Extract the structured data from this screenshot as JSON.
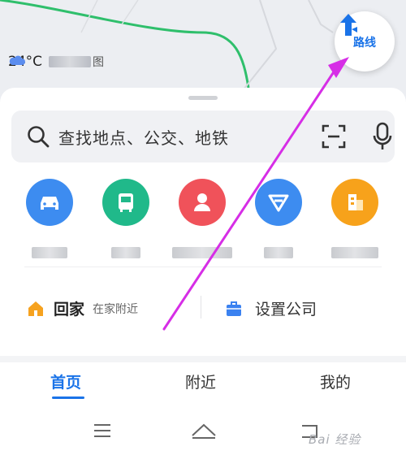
{
  "weather": {
    "temperature": "24°C",
    "suffix": "图",
    "icon": "cloud-icon"
  },
  "route_button": {
    "label": "路线",
    "icon": "route-arrow-icon"
  },
  "search": {
    "placeholder": "查找地点、公交、地铁",
    "scan_icon": "scan-icon",
    "mic_icon": "microphone-icon"
  },
  "shortcuts": [
    {
      "icon": "car-icon",
      "color": "#3d8cf0"
    },
    {
      "icon": "bus-icon",
      "color": "#20b98a"
    },
    {
      "icon": "person-icon",
      "color": "#f0525a"
    },
    {
      "icon": "route-badge-icon",
      "color": "#3d8cf0"
    },
    {
      "icon": "building-icon",
      "color": "#f7a21b"
    }
  ],
  "quick": {
    "home_label": "回家",
    "home_sub": "在家附近",
    "company_label": "设置公司"
  },
  "nav": {
    "tabs": [
      "首页",
      "附近",
      "我的"
    ],
    "active": 0
  },
  "watermark": "Bai 经验",
  "colors": {
    "accent": "#1a73e8",
    "route_green": "#2fbf6c",
    "annotation": "#d62ee6"
  }
}
